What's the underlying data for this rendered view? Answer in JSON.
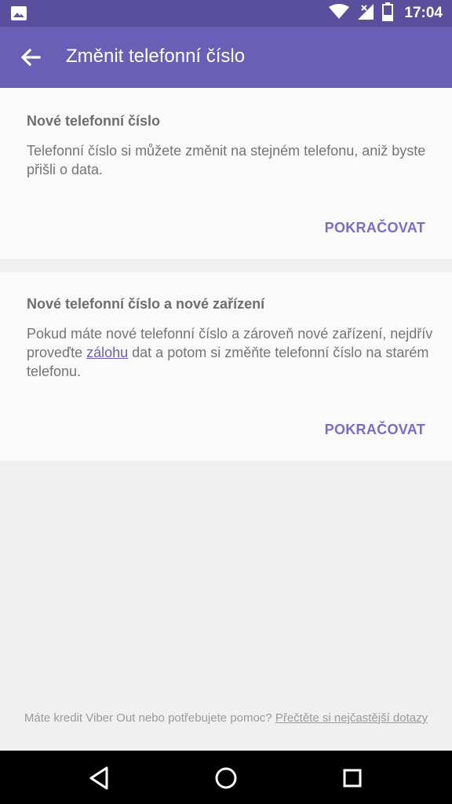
{
  "status_bar": {
    "time": "17:04",
    "icons": [
      "image-icon",
      "wifi-icon",
      "signal-icon",
      "battery-icon"
    ]
  },
  "app_bar": {
    "title": "Změnit telefonní číslo",
    "back_icon": "arrow-back-icon"
  },
  "card1": {
    "heading": "Nové telefonní číslo",
    "body": "Telefonní číslo si můžete změnit na stejném telefonu, aniž byste přišli o data.",
    "action": "POKRAČOVAT"
  },
  "card2": {
    "heading": "Nové telefonní číslo a nové zařízení",
    "body_before": "Pokud máte nové telefonní číslo a zároveň nové zařízení, nejdřív proveďte ",
    "link": "zálohu",
    "body_after": " dat a potom si změňte telefonní číslo na starém telefonu.",
    "action": "POKRAČOVAT"
  },
  "footer": {
    "text": "Máte kredit Viber Out nebo potřebujete pomoc? ",
    "link": "Přečtěte si nejčastější dotazy"
  },
  "nav_bar": {
    "icons": [
      "nav-back-icon",
      "nav-home-icon",
      "nav-recents-icon"
    ]
  },
  "colors": {
    "status_bar": "#5a4f9c",
    "app_bar": "#6a5fb6",
    "accent": "#7b6cc8"
  }
}
